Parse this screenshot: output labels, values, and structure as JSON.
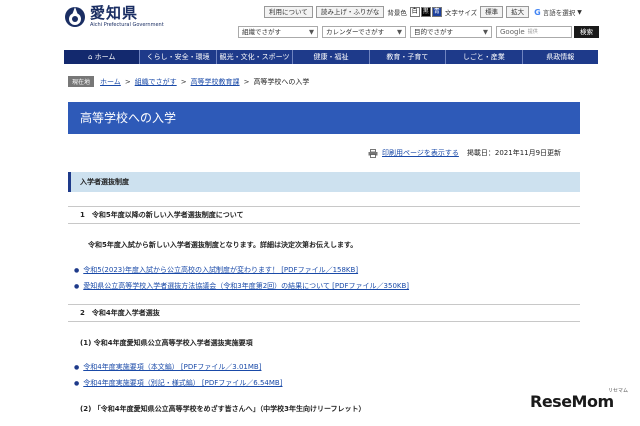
{
  "header": {
    "logo_title": "愛知県",
    "logo_sub": "Aichi Prefectural Government"
  },
  "utility": {
    "usage": "利用について",
    "read_aloud": "読み上げ・ふりがな",
    "bg_label": "背景色",
    "bg_white": "白",
    "bg_black": "黒",
    "bg_blue": "青",
    "text_size_label": "文字サイズ",
    "size_standard": "標準",
    "size_large": "拡大",
    "translate_g": "G",
    "translate_label": "言語を選択"
  },
  "search": {
    "org": "組織でさがす",
    "calendar": "カレンダーでさがす",
    "purpose": "目的でさがす",
    "google_label": "Google",
    "google_sub": "提供",
    "search_button": "検索"
  },
  "nav": {
    "home": "ホーム",
    "items": [
      "くらし・安全・環境",
      "観光・文化・スポーツ",
      "健康・福祉",
      "教育・子育て",
      "しごと・産業",
      "県政情報"
    ]
  },
  "breadcrumb": {
    "badge": "現在地",
    "links": [
      "ホーム",
      "組織でさがす",
      "高等学校教育課"
    ],
    "current": "高等学校への入学"
  },
  "page": {
    "title": "高等学校への入学",
    "print_link": "印刷用ページを表示する",
    "published": "掲載日：2021年11月9日更新"
  },
  "content": {
    "section_title": "入学者選抜制度",
    "sub1": "1　令和5年度以降の新しい入学者選抜制度について",
    "para1": "令和5年度入試から新しい入学者選抜制度となります。詳細は決定次第お伝えします。",
    "link1": "令和5(2023)年度入試から公立高校の入試制度が変わります！ [PDFファイル／158KB]",
    "link2": "愛知県公立高等学校入学者選抜方法協議会（令和3年度第2回）の結果について [PDFファイル／350KB]",
    "sub2": "2　令和4年度入学者選抜",
    "h4_1": "(1) 令和4年度愛知県公立高等学校入学者選抜実施要項",
    "link3": "令和4年度実施要項（本文編） [PDFファイル／3.01MB]",
    "link4": "令和4年度実施要項（別記・様式編） [PDFファイル／6.54MB]",
    "h4_2": "(2) 「令和4年度愛知県公立高等学校をめざす皆さんへ」（中学校3年生向けリーフレット）"
  },
  "watermark": {
    "text": "ReseMom",
    "sub": "リセマム"
  },
  "colors": {
    "nav_bg": "#1e3a8a",
    "title_banner": "#2e5ab8",
    "section_bar": "#cde1ef",
    "link": "#1a4aa8"
  }
}
